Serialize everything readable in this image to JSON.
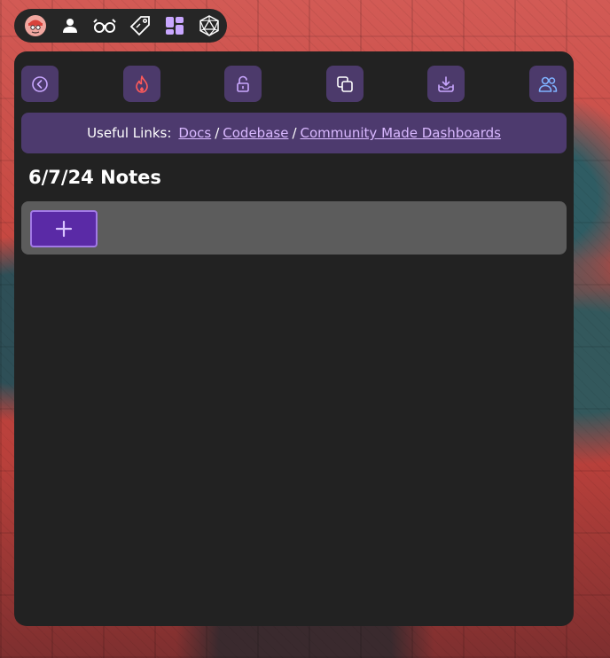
{
  "taskbar": {
    "items": [
      {
        "name": "profile-avatar-icon"
      },
      {
        "name": "person-icon"
      },
      {
        "name": "glasses-icon"
      },
      {
        "name": "tag-icon"
      },
      {
        "name": "dashboard-grid-icon"
      },
      {
        "name": "d20-dice-icon"
      }
    ]
  },
  "toolbar": {
    "buttons": [
      {
        "name": "back-button",
        "icon": "chevron-left-circle-icon",
        "color": "#c9a7ff"
      },
      {
        "name": "fire-button",
        "icon": "flame-icon",
        "color": "#ff5a5a"
      },
      {
        "name": "unlock-button",
        "icon": "unlock-icon",
        "color": "#c9a7ff"
      },
      {
        "name": "copy-button",
        "icon": "copy-icon",
        "color": "#ffffff"
      },
      {
        "name": "download-button",
        "icon": "download-tray-icon",
        "color": "#c9a7ff"
      },
      {
        "name": "users-button",
        "icon": "users-icon",
        "color": "#7fb2ff"
      }
    ]
  },
  "links": {
    "label": "Useful Links:",
    "docs": "Docs",
    "codebase": "Codebase",
    "community": "Community Made Dashboards",
    "separator": "/"
  },
  "page": {
    "title": "6/7/24 Notes"
  },
  "notes": {
    "add_label": "+"
  },
  "colors": {
    "panel": "#222222",
    "button_bg": "#4c3a6b",
    "links_bar": "#4d3a6e",
    "link_text": "#d9b8ff",
    "notes_row": "#5c5c5c",
    "add_button": "#5a2aa6",
    "add_button_border": "#a27ae6"
  }
}
